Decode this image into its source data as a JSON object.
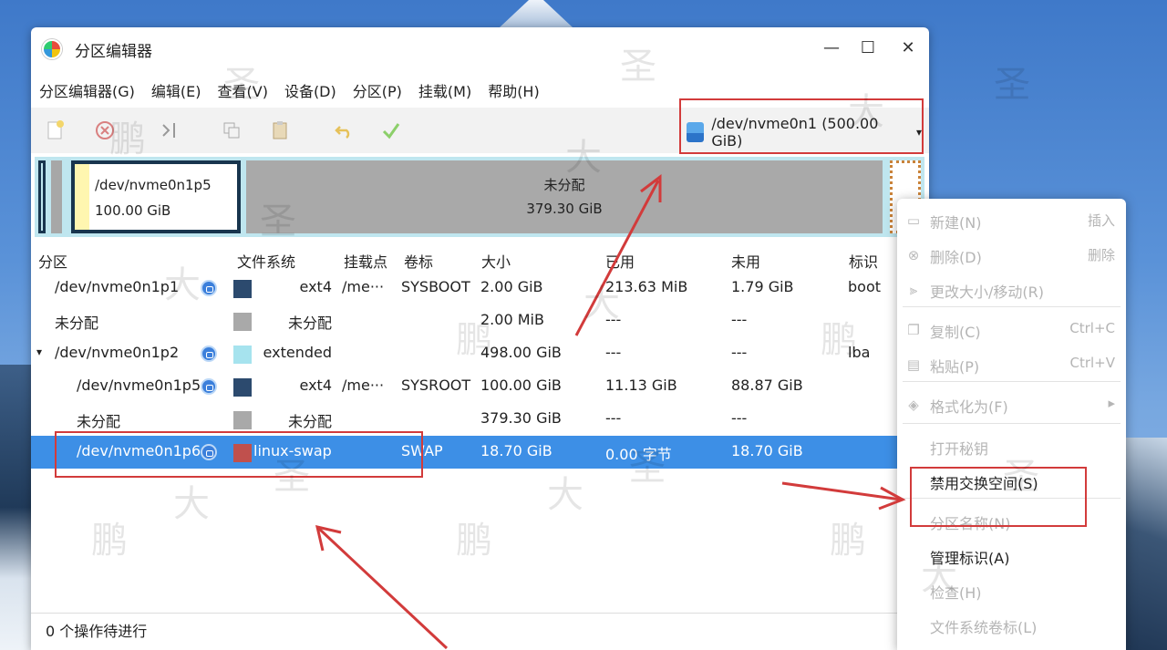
{
  "window": {
    "title": "分区编辑器",
    "minimize": "—",
    "maximize": "☐",
    "close": "✕"
  },
  "menubar": [
    "分区编辑器(G)",
    "编辑(E)",
    "查看(V)",
    "设备(D)",
    "分区(P)",
    "挂载(M)",
    "帮助(H)"
  ],
  "device": {
    "label": "/dev/nvme0n1 (500.00 GiB)",
    "arrow": "▾"
  },
  "partition_bar": {
    "selected_name": "/dev/nvme0n1p5",
    "selected_size": "100.00 GiB",
    "unallocated_label": "未分配",
    "unallocated_size": "379.30 GiB"
  },
  "table": {
    "headers": [
      "分区",
      "文件系统",
      "挂载点",
      "卷标",
      "大小",
      "已用",
      "未用",
      "标识"
    ],
    "rows": [
      {
        "name": "/dev/nvme0n1p1",
        "lock": true,
        "color": "#2c4a6e",
        "fs": "ext4",
        "mount": "/me···",
        "label": "SYSBOOT",
        "size": "2.00 GiB",
        "used": "213.63 MiB",
        "unused": "1.79 GiB",
        "flags": "boot"
      },
      {
        "name": "未分配",
        "lock": false,
        "color": "#a9a9a9",
        "fs": "未分配",
        "mount": "",
        "label": "",
        "size": "2.00 MiB",
        "used": "---",
        "unused": "---",
        "flags": ""
      },
      {
        "name": "/dev/nvme0n1p2",
        "lock": true,
        "color": "#a6e3ee",
        "fs": "extended",
        "mount": "",
        "label": "",
        "size": "498.00 GiB",
        "used": "---",
        "unused": "---",
        "flags": "lba",
        "expander": "▾"
      },
      {
        "name": "/dev/nvme0n1p5",
        "lock": true,
        "color": "#2c4a6e",
        "fs": "ext4",
        "mount": "/me···",
        "label": "SYSROOT",
        "size": "100.00 GiB",
        "used": "11.13 GiB",
        "unused": "88.87 GiB",
        "flags": ""
      },
      {
        "name": "未分配",
        "lock": false,
        "color": "#a9a9a9",
        "fs": "未分配",
        "mount": "",
        "label": "",
        "size": "379.30 GiB",
        "used": "---",
        "unused": "---",
        "flags": ""
      },
      {
        "name": "/dev/nvme0n1p6",
        "lock": true,
        "color": "#c0504d",
        "fs": "linux-swap",
        "mount": "",
        "label": "SWAP",
        "size": "18.70 GiB",
        "used": "0.00 字节",
        "unused": "18.70 GiB",
        "flags": "",
        "selected": true
      }
    ]
  },
  "status": "0 个操作待进行",
  "context_menu": [
    {
      "label": "新建(N)",
      "shortcut": "插入",
      "disabled": true,
      "icon": "new-icon"
    },
    {
      "label": "删除(D)",
      "shortcut": "删除",
      "disabled": true,
      "icon": "delete-icon"
    },
    {
      "label": "更改大小/移动(R)",
      "shortcut": "",
      "disabled": true,
      "icon": "resize-icon",
      "sep_after": true
    },
    {
      "label": "复制(C)",
      "shortcut": "Ctrl+C",
      "disabled": true,
      "icon": "copy-icon"
    },
    {
      "label": "粘贴(P)",
      "shortcut": "Ctrl+V",
      "disabled": true,
      "icon": "paste-icon",
      "sep_after": true
    },
    {
      "label": "格式化为(F)",
      "shortcut": "▸",
      "disabled": true,
      "icon": "format-icon",
      "sep_after": true
    },
    {
      "label": "打开秘钥",
      "shortcut": "",
      "disabled": true,
      "icon": ""
    },
    {
      "label": "禁用交换空间(S)",
      "shortcut": "",
      "disabled": false,
      "icon": "",
      "sep_after": true
    },
    {
      "label": "分区名称(N)",
      "shortcut": "",
      "disabled": true,
      "icon": ""
    },
    {
      "label": "管理标识(A)",
      "shortcut": "",
      "disabled": false,
      "icon": ""
    },
    {
      "label": "检查(H)",
      "shortcut": "",
      "disabled": true,
      "icon": ""
    },
    {
      "label": "文件系统卷标(L)",
      "shortcut": "",
      "disabled": true,
      "icon": ""
    }
  ],
  "watermark": [
    "大",
    "圣",
    "鹏"
  ],
  "colors": {
    "accent": "#3d8fe6",
    "highlight": "#d23b3b"
  }
}
